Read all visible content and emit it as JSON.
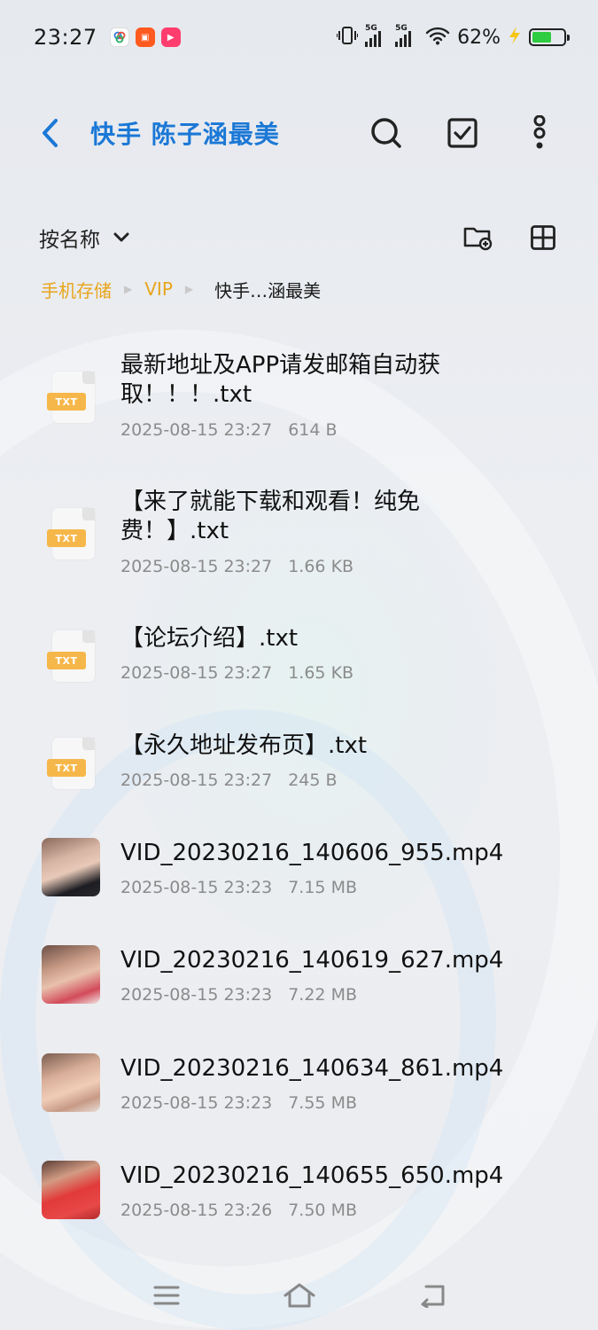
{
  "status_bar": {
    "time": "23:27",
    "network_1": "5G",
    "network_2": "5G",
    "battery_percent": "62%",
    "battery_level": 0.62,
    "colors": {
      "battery_fill": "#2ecc40"
    }
  },
  "header": {
    "title": "快手  陈子涵最美",
    "accent_color": "#1b78d6",
    "back_icon": "chevron-left-icon",
    "search_icon": "search-icon",
    "select_icon": "checkbox-icon",
    "more_icon": "more-vertical-icon"
  },
  "toolbar": {
    "sort_label": "按名称",
    "sort_icon": "chevron-down-icon",
    "new_folder_icon": "new-folder-icon",
    "view_toggle_icon": "grid-view-icon"
  },
  "breadcrumb": {
    "items": [
      "手机存储",
      "VIP"
    ],
    "current": "快手…涵最美",
    "link_color": "#e8a51c"
  },
  "files": [
    {
      "type": "txt",
      "name": "最新地址及APP请发邮箱自动获取！！！.txt",
      "date": "2025-08-15 23:27",
      "size": "614 B",
      "icon_label": "TXT"
    },
    {
      "type": "txt",
      "name": "【来了就能下载和观看！纯免费！】.txt",
      "date": "2025-08-15 23:27",
      "size": "1.66 KB",
      "icon_label": "TXT"
    },
    {
      "type": "txt",
      "name": "【论坛介绍】.txt",
      "date": "2025-08-15 23:27",
      "size": "1.65 KB",
      "icon_label": "TXT"
    },
    {
      "type": "txt",
      "name": "【永久地址发布页】.txt",
      "date": "2025-08-15 23:27",
      "size": "245 B",
      "icon_label": "TXT"
    },
    {
      "type": "video",
      "name": "VID_20230216_140606_955.mp4",
      "date": "2025-08-15 23:23",
      "size": "7.15 MB"
    },
    {
      "type": "video",
      "name": "VID_20230216_140619_627.mp4",
      "date": "2025-08-15 23:23",
      "size": "7.22 MB"
    },
    {
      "type": "video",
      "name": "VID_20230216_140634_861.mp4",
      "date": "2025-08-15 23:23",
      "size": "7.55 MB"
    },
    {
      "type": "video",
      "name": "VID_20230216_140655_650.mp4",
      "date": "2025-08-15 23:26",
      "size": "7.50 MB"
    }
  ],
  "nav_bar": {
    "menu_icon": "menu-icon",
    "home_icon": "home-icon",
    "back_icon": "back-icon"
  }
}
